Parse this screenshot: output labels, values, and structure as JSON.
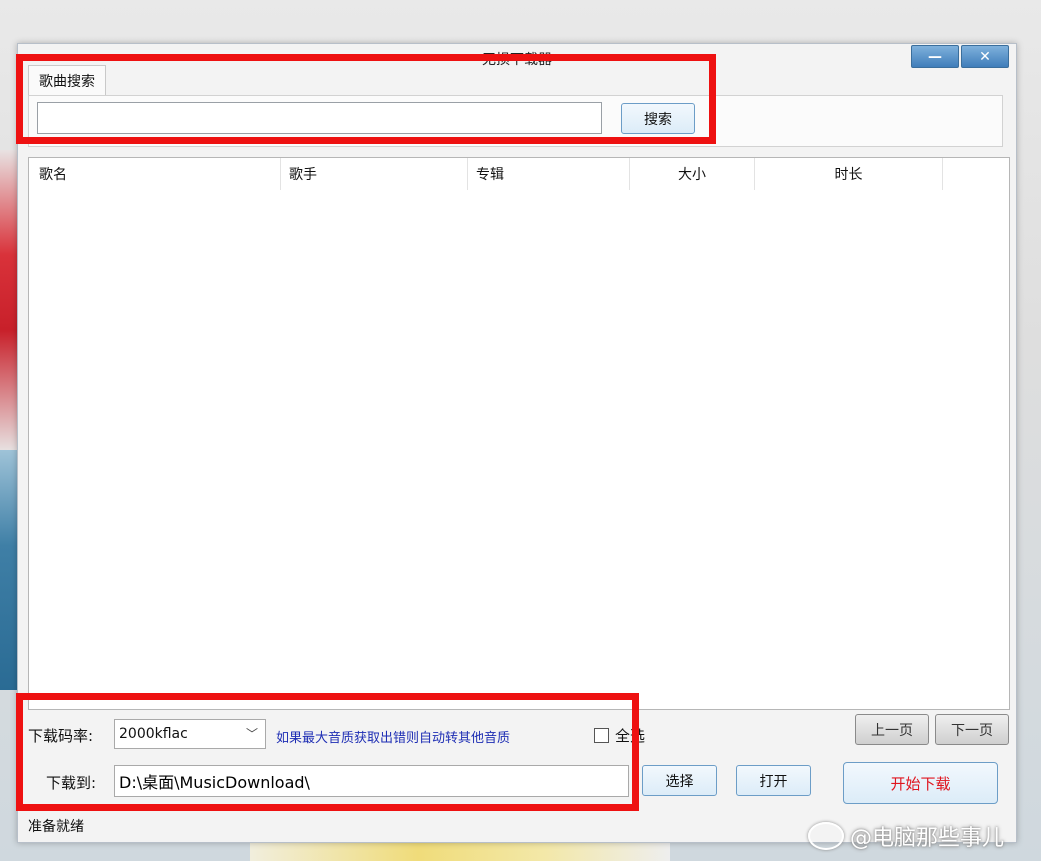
{
  "window": {
    "title": "无损下载器",
    "minimize_label": "—",
    "close_label": "✕"
  },
  "search": {
    "tab_label": "歌曲搜索",
    "input_value": "",
    "button_label": "搜索"
  },
  "list": {
    "columns": [
      "歌名",
      "歌手",
      "专辑",
      "大小",
      "时长"
    ]
  },
  "bottom": {
    "bitrate_label": "下载码率:",
    "bitrate_value": "2000kflac",
    "quality_hint": "如果最大音质获取出错则自动转其他音质",
    "select_all_label": "全选",
    "prev_page": "上一页",
    "next_page": "下一页",
    "download_to_label": "下载到:",
    "download_path": "D:\\桌面\\MusicDownload\\",
    "choose_button": "选择",
    "open_button": "打开",
    "start_button": "开始下载",
    "status": "准备就绪"
  },
  "watermark": "@电脑那些事儿",
  "colors": {
    "annotation_red": "#ee1111",
    "hint_blue": "#1e2eb4",
    "start_red": "#e0141e",
    "title_button_blue": "#3f7dba"
  }
}
